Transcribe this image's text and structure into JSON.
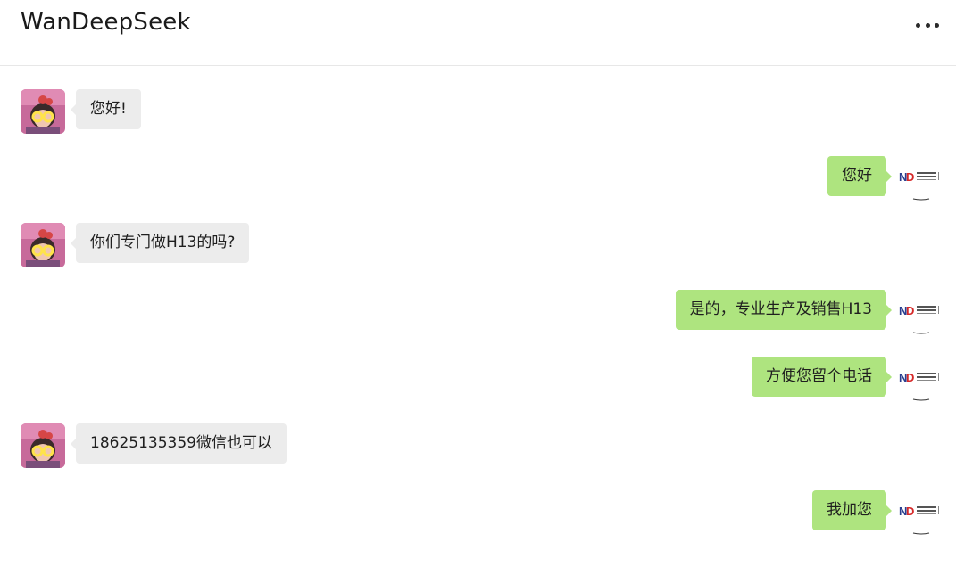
{
  "header": {
    "title": "WanDeepSeek",
    "menu_icon": "more-horizontal-icon"
  },
  "messages": [
    {
      "side": "left",
      "text": "您好!"
    },
    {
      "side": "right",
      "text": "您好"
    },
    {
      "side": "left",
      "text": "你们专门做H13的吗?"
    },
    {
      "side": "right",
      "text": "是的，专业生产及销售H13"
    },
    {
      "side": "right",
      "text": "方便您留个电话"
    },
    {
      "side": "left",
      "text": "18625135359微信也可以"
    },
    {
      "side": "right",
      "text": "我加您"
    }
  ],
  "colors": {
    "left_bubble": "#ececec",
    "right_bubble": "#aee47f",
    "divider": "#e7e7e7"
  }
}
